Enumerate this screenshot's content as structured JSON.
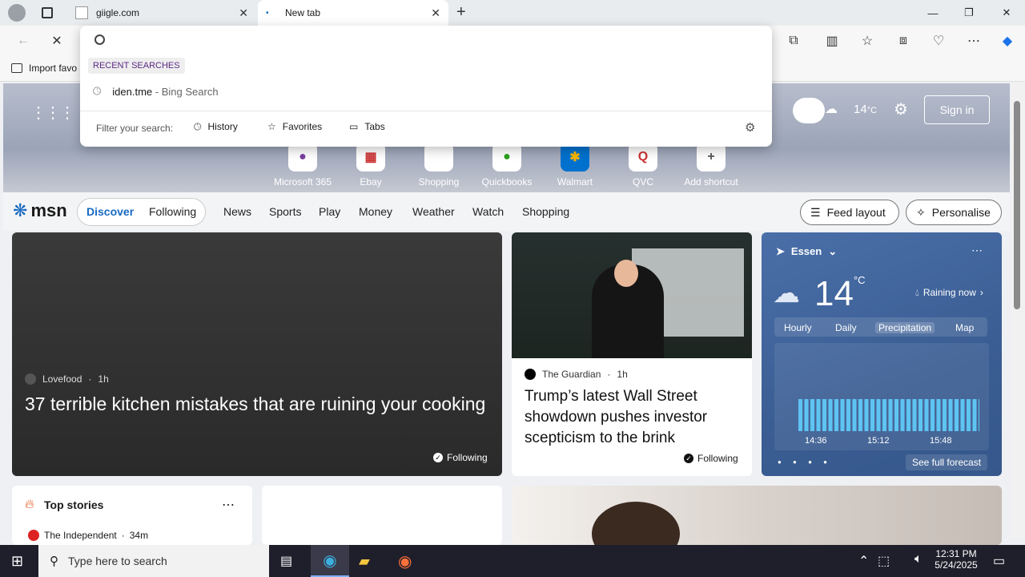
{
  "tabs": [
    {
      "title": "giigle.com"
    },
    {
      "title": "New tab"
    }
  ],
  "favorites_bar": {
    "import_label": "Import favo"
  },
  "dropdown": {
    "section_label": "RECENT SEARCHES",
    "recent": [
      {
        "text": "iden.tme",
        "suffix": " - Bing Search"
      }
    ],
    "filter_label": "Filter your search:",
    "filters": [
      "History",
      "Favorites",
      "Tabs"
    ]
  },
  "hero": {
    "temp": "14",
    "temp_unit": "°C",
    "signin": "Sign in"
  },
  "shortcuts": [
    "Microsoft 365",
    "Ebay",
    "Shopping",
    "Quickbooks",
    "Walmart",
    "QVC",
    "Add shortcut"
  ],
  "msn": {
    "logo": "msn",
    "tabs": [
      "Discover",
      "Following"
    ],
    "nav": [
      "News",
      "Sports",
      "Play",
      "Money",
      "Weather",
      "Watch",
      "Shopping"
    ],
    "feed_layout": "Feed layout",
    "personalise": "Personalise"
  },
  "card_main": {
    "source": "Lovefood",
    "age": "1h",
    "title": "37 terrible kitchen mistakes that are ruining your cooking",
    "follow": "Following"
  },
  "card_news": {
    "source": "The Guardian",
    "age": "1h",
    "title": "Trump’s latest Wall Street showdown pushes investor scepticism to the brink",
    "follow": "Following"
  },
  "weather": {
    "location": "Essen",
    "temp": "14",
    "unit": "°C",
    "status": "Raining now",
    "tabs": [
      "Hourly",
      "Daily",
      "Precipitation",
      "Map"
    ],
    "active_tab": "Precipitation",
    "times": [
      "14:36",
      "15:12",
      "15:48"
    ],
    "see_full": "See full forecast"
  },
  "top_stories": {
    "title": "Top stories",
    "source": "The Independent",
    "age": "34m"
  },
  "taskbar": {
    "search_placeholder": "Type here to search",
    "time": "12:31 PM",
    "date": "5/24/2025"
  },
  "colors": {
    "accent": "#0067b8",
    "msn_blue": "#1769c1"
  }
}
